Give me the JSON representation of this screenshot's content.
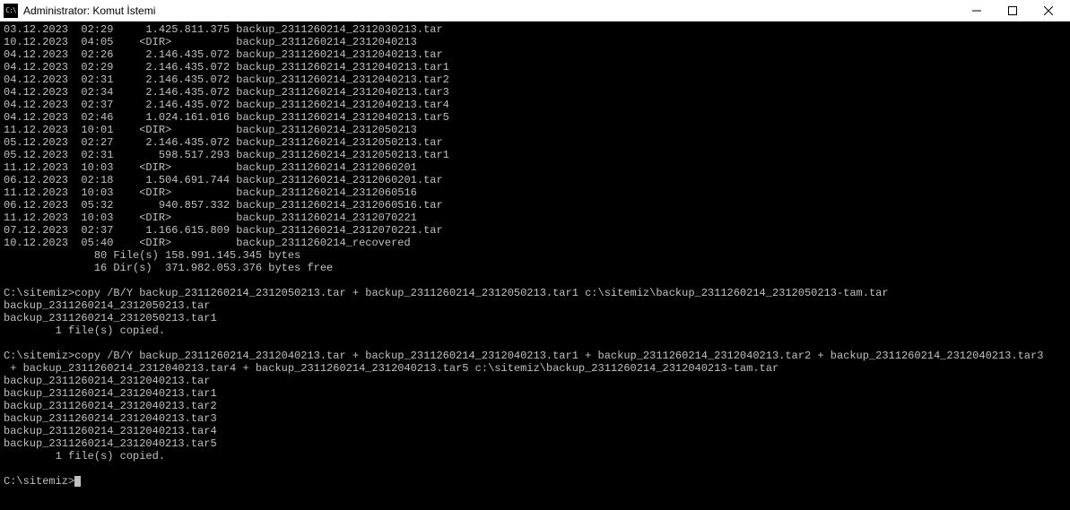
{
  "window": {
    "icon_text": "C:\\",
    "title": "Administrator: Komut İstemi"
  },
  "listing": {
    "rows": [
      {
        "date": "03.12.2023",
        "time": "02:29",
        "size": "1.425.811.375",
        "name": "backup_2311260214_2312030213.tar"
      },
      {
        "date": "10.12.2023",
        "time": "04:05",
        "size": "<DIR>",
        "name": "backup_2311260214_2312040213"
      },
      {
        "date": "04.12.2023",
        "time": "02:26",
        "size": "2.146.435.072",
        "name": "backup_2311260214_2312040213.tar"
      },
      {
        "date": "04.12.2023",
        "time": "02:29",
        "size": "2.146.435.072",
        "name": "backup_2311260214_2312040213.tar1"
      },
      {
        "date": "04.12.2023",
        "time": "02:31",
        "size": "2.146.435.072",
        "name": "backup_2311260214_2312040213.tar2"
      },
      {
        "date": "04.12.2023",
        "time": "02:34",
        "size": "2.146.435.072",
        "name": "backup_2311260214_2312040213.tar3"
      },
      {
        "date": "04.12.2023",
        "time": "02:37",
        "size": "2.146.435.072",
        "name": "backup_2311260214_2312040213.tar4"
      },
      {
        "date": "04.12.2023",
        "time": "02:46",
        "size": "1.024.161.016",
        "name": "backup_2311260214_2312040213.tar5"
      },
      {
        "date": "11.12.2023",
        "time": "10:01",
        "size": "<DIR>",
        "name": "backup_2311260214_2312050213"
      },
      {
        "date": "05.12.2023",
        "time": "02:27",
        "size": "2.146.435.072",
        "name": "backup_2311260214_2312050213.tar"
      },
      {
        "date": "05.12.2023",
        "time": "02:31",
        "size": "598.517.293",
        "name": "backup_2311260214_2312050213.tar1"
      },
      {
        "date": "11.12.2023",
        "time": "10:03",
        "size": "<DIR>",
        "name": "backup_2311260214_2312060201"
      },
      {
        "date": "06.12.2023",
        "time": "02:18",
        "size": "1.504.691.744",
        "name": "backup_2311260214_2312060201.tar"
      },
      {
        "date": "11.12.2023",
        "time": "10:03",
        "size": "<DIR>",
        "name": "backup_2311260214_2312060516"
      },
      {
        "date": "06.12.2023",
        "time": "05:32",
        "size": "940.857.332",
        "name": "backup_2311260214_2312060516.tar"
      },
      {
        "date": "11.12.2023",
        "time": "10:03",
        "size": "<DIR>",
        "name": "backup_2311260214_2312070221"
      },
      {
        "date": "07.12.2023",
        "time": "02:37",
        "size": "1.166.615.809",
        "name": "backup_2311260214_2312070221.tar"
      },
      {
        "date": "10.12.2023",
        "time": "05:40",
        "size": "<DIR>",
        "name": "backup_2311260214_recovered"
      }
    ],
    "summary_files": "              80 File(s) 158.991.145.345 bytes",
    "summary_dirs": "              16 Dir(s)  371.982.053.376 bytes free"
  },
  "commands": {
    "cmd1_prompt": "C:\\sitemiz>",
    "cmd1": "copy /B/Y backup_2311260214_2312050213.tar + backup_2311260214_2312050213.tar1 c:\\sitemiz\\backup_2311260214_2312050213-tam.tar",
    "cmd1_out": [
      "backup_2311260214_2312050213.tar",
      "backup_2311260214_2312050213.tar1",
      "        1 file(s) copied."
    ],
    "cmd2_prompt": "C:\\sitemiz>",
    "cmd2_line1": "copy /B/Y backup_2311260214_2312040213.tar + backup_2311260214_2312040213.tar1 + backup_2311260214_2312040213.tar2 + backup_2311260214_2312040213.tar3",
    "cmd2_line2": " + backup_2311260214_2312040213.tar4 + backup_2311260214_2312040213.tar5 c:\\sitemiz\\backup_2311260214_2312040213-tam.tar",
    "cmd2_out": [
      "backup_2311260214_2312040213.tar",
      "backup_2311260214_2312040213.tar1",
      "backup_2311260214_2312040213.tar2",
      "backup_2311260214_2312040213.tar3",
      "backup_2311260214_2312040213.tar4",
      "backup_2311260214_2312040213.tar5",
      "        1 file(s) copied."
    ],
    "final_prompt": "C:\\sitemiz>"
  }
}
